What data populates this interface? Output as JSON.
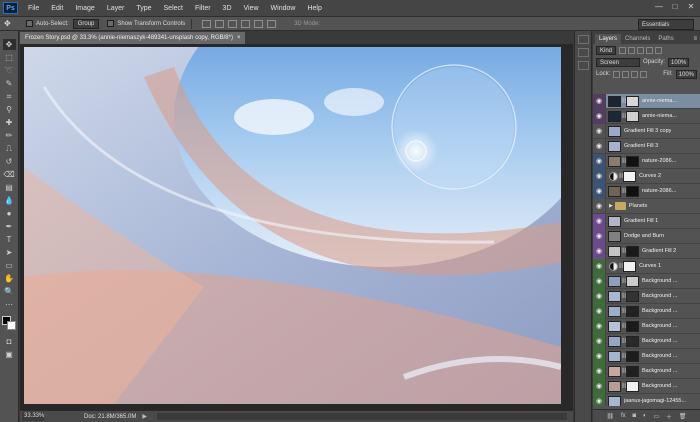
{
  "app": {
    "logo": "Ps"
  },
  "menu": [
    "File",
    "Edit",
    "Image",
    "Layer",
    "Type",
    "Select",
    "Filter",
    "3D",
    "View",
    "Window",
    "Help"
  ],
  "window_controls": {
    "minimize": "—",
    "maximize": "□",
    "close": "✕"
  },
  "options_bar": {
    "auto_select_label": "Auto-Select:",
    "auto_select_target": "Group",
    "show_transform_label": "Show Transform Controls",
    "mode_3d_label": "3D Mode:",
    "workspace": "Essentials"
  },
  "document": {
    "tab_title": "Frozen Story.psd @ 33.3% (annie-niemaszyk-489341-unsplash copy, RGB/8*)",
    "close": "×",
    "zoom": "33.33%",
    "doc_info": "Doc: 21.8M/365.0M"
  },
  "layers_panel": {
    "tabs": [
      "Layers",
      "Channels",
      "Paths"
    ],
    "kind_label": "Kind",
    "blend_mode": "Screen",
    "opacity_label": "Opacity:",
    "opacity_value": "100%",
    "lock_label": "Lock:",
    "fill_label": "Fill:",
    "fill_value": "100%",
    "layers": [
      {
        "name": "annie-niema...",
        "type": "image",
        "color": "#533d62",
        "visible": true,
        "selected": true,
        "thumb": "#1b2430",
        "mask": "#d8d8d8"
      },
      {
        "name": "annie-niema...",
        "type": "image",
        "color": "#533d62",
        "visible": true,
        "selected": false,
        "thumb": "#1d2836",
        "mask": "#cfcfcf"
      },
      {
        "name": "Gradient Fill 3 copy",
        "type": "fill",
        "color": "",
        "visible": true,
        "selected": false,
        "thumb": "#9da9c8",
        "mask": ""
      },
      {
        "name": "Gradient Fill 3",
        "type": "fill",
        "color": "",
        "visible": true,
        "selected": false,
        "thumb": "#a8b2cf",
        "mask": ""
      },
      {
        "name": "nature-2086...",
        "type": "image",
        "color": "#3c5372",
        "visible": true,
        "selected": false,
        "thumb": "#8a7d6f",
        "mask": "#111111"
      },
      {
        "name": "Curves 2",
        "type": "adjustment",
        "color": "#3c5372",
        "visible": true,
        "selected": false,
        "thumb": "",
        "mask": "#f2f2f2"
      },
      {
        "name": "nature-2086...",
        "type": "image",
        "color": "#3c5372",
        "visible": true,
        "selected": false,
        "thumb": "#6f6556",
        "mask": "#101010"
      },
      {
        "name": "Planets",
        "type": "group",
        "color": "",
        "visible": true,
        "selected": false,
        "thumb": "",
        "mask": ""
      },
      {
        "name": "Gradient Fill 1",
        "type": "fill",
        "color": "#6b4b89",
        "visible": true,
        "selected": false,
        "thumb": "#b3b3c9",
        "mask": ""
      },
      {
        "name": "Dodge and Burn",
        "type": "image",
        "color": "#6b4b89",
        "visible": true,
        "selected": false,
        "thumb": "#808080",
        "mask": ""
      },
      {
        "name": "Gradient Fill 2",
        "type": "fill",
        "color": "#6b4b89",
        "visible": true,
        "selected": false,
        "thumb": "#c4c4c4",
        "mask": "#1a1a1a"
      },
      {
        "name": "Curves 1",
        "type": "adjustment",
        "color": "#3f6a3a",
        "visible": true,
        "selected": false,
        "thumb": "",
        "mask": "#f2f2f2"
      },
      {
        "name": "Background ...",
        "type": "image",
        "color": "#3f6a3a",
        "visible": true,
        "selected": false,
        "thumb": "#8fa0be",
        "mask": "#cccccc"
      },
      {
        "name": "Background ...",
        "type": "image",
        "color": "#3f6a3a",
        "visible": true,
        "selected": false,
        "thumb": "#a9b8d2",
        "mask": "#333333"
      },
      {
        "name": "Background ...",
        "type": "image",
        "color": "#3f6a3a",
        "visible": true,
        "selected": false,
        "thumb": "#9caec8",
        "mask": "#222222"
      },
      {
        "name": "Background ...",
        "type": "image",
        "color": "#3f6a3a",
        "visible": true,
        "selected": false,
        "thumb": "#b5c2d8",
        "mask": "#1a1a1a"
      },
      {
        "name": "Background ...",
        "type": "image",
        "color": "#3f6a3a",
        "visible": true,
        "selected": false,
        "thumb": "#93a7c4",
        "mask": "#2a2a2a"
      },
      {
        "name": "Background ...",
        "type": "image",
        "color": "#3f6a3a",
        "visible": true,
        "selected": false,
        "thumb": "#a4b4cd",
        "mask": "#1d1d1d"
      },
      {
        "name": "Background ...",
        "type": "image",
        "color": "#3f6a3a",
        "visible": true,
        "selected": false,
        "thumb": "#c7a8a0",
        "mask": "#202020"
      },
      {
        "name": "Background ...",
        "type": "image",
        "color": "#3f6a3a",
        "visible": true,
        "selected": false,
        "thumb": "#b49d98",
        "mask": "#f0f0f0"
      },
      {
        "name": "jaanus-jagomagi-12455...",
        "type": "image",
        "color": "#3f6a3a",
        "visible": true,
        "selected": false,
        "thumb": "#a8b6cf",
        "mask": ""
      }
    ]
  },
  "colors": {
    "accent_selected": "#7b8da3"
  }
}
